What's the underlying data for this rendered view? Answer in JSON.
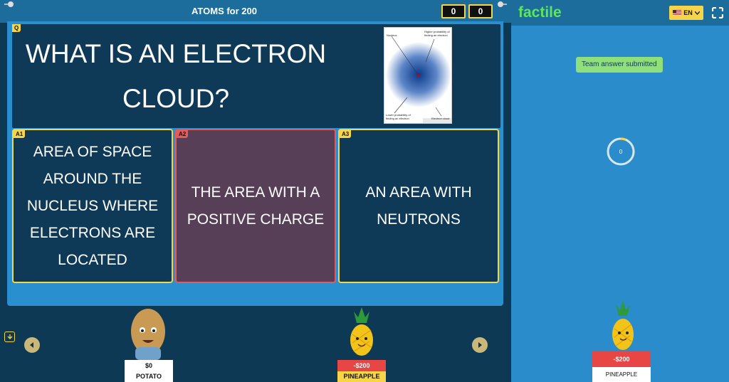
{
  "header": {
    "title": "ATOMS for 200",
    "team_scores": [
      "0",
      "0"
    ]
  },
  "question": {
    "tag": "Q",
    "text": "WHAT IS AN ELECTRON CLOUD?",
    "image_labels": {
      "nucleus": "Nucleus",
      "higher": "Higher probability of finding an electron",
      "lower": "Lower probability of finding an electron",
      "cloud": "Electron cloud"
    }
  },
  "answers": [
    {
      "tag": "A1",
      "text": "AREA OF SPACE AROUND THE NUCLEUS WHERE ELECTRONS ARE LOCATED"
    },
    {
      "tag": "A2",
      "text": "THE AREA WITH A POSITIVE CHARGE"
    },
    {
      "tag": "A3",
      "text": "AN AREA WITH NEUTRONS"
    }
  ],
  "players": [
    {
      "amount": "$0",
      "name": "POTATO",
      "icon": "potato-avatar"
    },
    {
      "amount": "-$200",
      "name": "PINEAPPLE",
      "icon": "pineapple-avatar"
    }
  ],
  "side": {
    "logo": "factile",
    "language": "EN",
    "toast": "Team answer submitted",
    "timer": "0",
    "player": {
      "amount": "-$200",
      "name": "PINEAPPLE"
    }
  },
  "colors": {
    "accent": "#f6d548",
    "card": "#0f3a57",
    "board": "#2a8fcf",
    "wrong": "#e85a5a",
    "logo": "#5ee55e"
  }
}
